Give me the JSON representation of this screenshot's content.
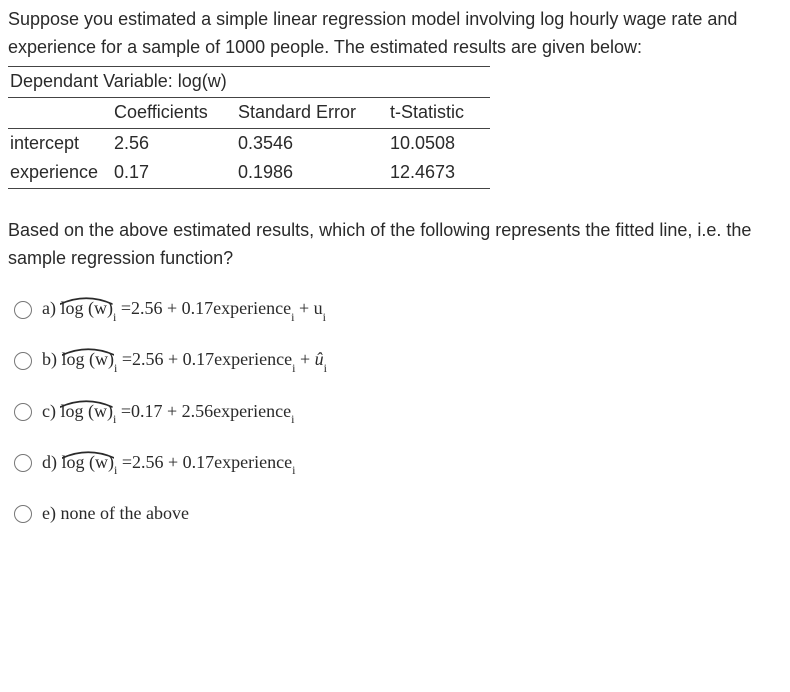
{
  "intro": "Suppose you estimated a simple linear regression model involving log hourly wage rate  and experience for a sample of 1000 people. The estimated results are given below:",
  "table": {
    "dep_label": "Dependant Variable: log(w)",
    "headers": {
      "c0": "",
      "c1": "Coefficients",
      "c2": "Standard Error",
      "c3": "t-Statistic"
    },
    "rows": [
      {
        "label": "intercept",
        "coef": "2.56",
        "se": "0.3546",
        "t": "10.0508"
      },
      {
        "label": "experience",
        "coef": "0.17",
        "se": "0.1986",
        "t": "12.4673"
      }
    ]
  },
  "question": "Based on the above estimated results, which of the following represents the fitted line, i.e. the sample regression function?",
  "options": {
    "a": {
      "letter": "a) ",
      "lhs_log": "log ",
      "lhs_w": "(w)",
      "lhs_sub": "i",
      "rhs": " =2.56 + 0.17experience",
      "rhs_sub": "i",
      "tail": " + u",
      "tail_sub": "i"
    },
    "b": {
      "letter": "b) ",
      "lhs_log": "log ",
      "lhs_w": "(w)",
      "lhs_sub": "i",
      "rhs": " =2.56 + 0.17experience",
      "rhs_sub": "i",
      "tail": " + ",
      "tail_u": "û",
      "tail_sub": "i"
    },
    "c": {
      "letter": "c) ",
      "lhs_log": "log ",
      "lhs_w": "(w)",
      "lhs_sub": "i",
      "rhs": " =0.17 + 2.56experience",
      "rhs_sub": "i"
    },
    "d": {
      "letter": "d) ",
      "lhs_log": "log ",
      "lhs_w": "(w)",
      "lhs_sub": "i",
      "rhs": " =2.56 + 0.17experience",
      "rhs_sub": "i"
    },
    "e": {
      "letter": "e) ",
      "text": "none of the above"
    }
  }
}
